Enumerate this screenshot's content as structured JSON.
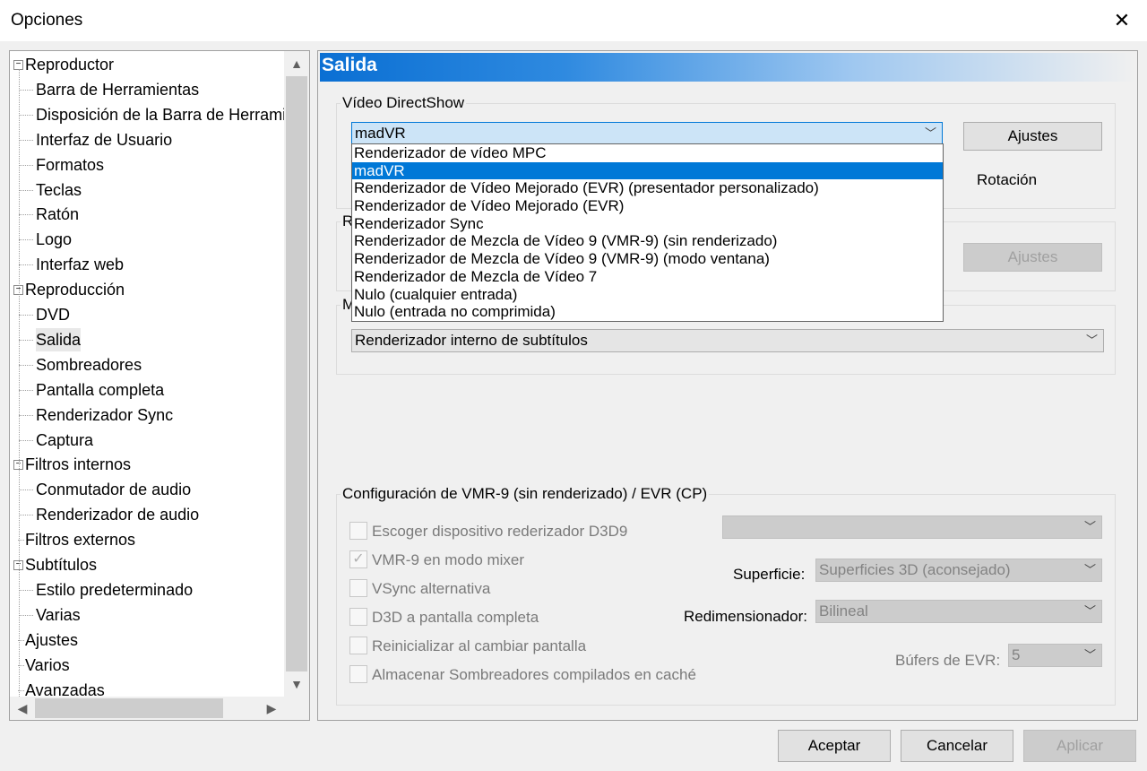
{
  "window": {
    "title": "Opciones",
    "close_glyph": "✕"
  },
  "tree": {
    "items": [
      {
        "label": "Reproductor",
        "level": 0,
        "expander": "−"
      },
      {
        "label": "Barra de Herramientas",
        "level": 1
      },
      {
        "label": "Disposición de la Barra de Herramientas",
        "level": 1
      },
      {
        "label": "Interfaz de Usuario",
        "level": 1
      },
      {
        "label": "Formatos",
        "level": 1
      },
      {
        "label": "Teclas",
        "level": 1
      },
      {
        "label": "Ratón",
        "level": 1
      },
      {
        "label": "Logo",
        "level": 1
      },
      {
        "label": "Interfaz web",
        "level": 1
      },
      {
        "label": "Reproducción",
        "level": 0,
        "expander": "−"
      },
      {
        "label": "DVD",
        "level": 1
      },
      {
        "label": "Salida",
        "level": 1,
        "selected": true
      },
      {
        "label": "Sombreadores",
        "level": 1
      },
      {
        "label": "Pantalla completa",
        "level": 1
      },
      {
        "label": "Renderizador Sync",
        "level": 1
      },
      {
        "label": "Captura",
        "level": 1
      },
      {
        "label": "Filtros internos",
        "level": 0,
        "expander": "−"
      },
      {
        "label": "Conmutador de audio",
        "level": 1
      },
      {
        "label": "Renderizador de audio",
        "level": 1
      },
      {
        "label": "Filtros externos",
        "level": 0
      },
      {
        "label": "Subtítulos",
        "level": 0,
        "expander": "−"
      },
      {
        "label": "Estilo predeterminado",
        "level": 1
      },
      {
        "label": "Varias",
        "level": 1
      },
      {
        "label": "Ajustes",
        "level": 0
      },
      {
        "label": "Varios",
        "level": 0
      },
      {
        "label": "Avanzadas",
        "level": 0
      }
    ],
    "scroll_up": "▲",
    "scroll_down": "▼",
    "scroll_left": "◀",
    "scroll_right": "▶"
  },
  "panel": {
    "title": "Salida",
    "directshow": {
      "legend": "Vídeo DirectShow",
      "selected": "madVR",
      "settings_button": "Ajustes",
      "rotation_label": "Rotación",
      "options": [
        "Renderizador de vídeo MPC",
        "madVR",
        "Renderizador de Vídeo Mejorado (EVR) (presentador personalizado)",
        "Renderizador de Vídeo Mejorado (EVR)",
        "Renderizador Sync",
        "Renderizador de Mezcla de Vídeo 9 (VMR-9) (sin renderizado)",
        "Renderizador de Mezcla de Vídeo 9 (VMR-9) (modo ventana)",
        "Renderizador de Mezcla de Vídeo 7",
        "Nulo (cualquier entrada)",
        "Nulo (entrada no comprimida)"
      ],
      "selected_index": 1
    },
    "second_group": {
      "legend": "R",
      "settings_button": "Ajustes"
    },
    "subtitle_group": {
      "legend": "M",
      "selected": "Renderizador interno de subtítulos"
    },
    "vmr": {
      "legend": "Configuración de VMR-9 (sin renderizado) / EVR (CP)",
      "checkboxes": [
        {
          "label": "Escoger dispositivo rederizador D3D9",
          "checked": false
        },
        {
          "label": "VMR-9 en modo mixer",
          "checked": true
        },
        {
          "label": "VSync alternativa",
          "checked": false
        },
        {
          "label": "D3D a pantalla completa",
          "checked": false
        },
        {
          "label": "Reinicializar al cambiar pantalla",
          "checked": false
        },
        {
          "label": "Almacenar Sombreadores compilados en caché",
          "checked": false
        }
      ],
      "device_value": "",
      "surface_label": "Superficie:",
      "surface_value": "Superficies 3D (aconsejado)",
      "resizer_label": "Redimensionador:",
      "resizer_value": "Bilineal",
      "evr_buffers_label": "Búfers de EVR:",
      "evr_buffers_value": "5",
      "check_glyph": "✓"
    }
  },
  "footer": {
    "accept": "Aceptar",
    "cancel": "Cancelar",
    "apply": "Aplicar"
  },
  "colors": {
    "accent": "#0078d7",
    "header_gradient_start": "#0a6fd3"
  }
}
